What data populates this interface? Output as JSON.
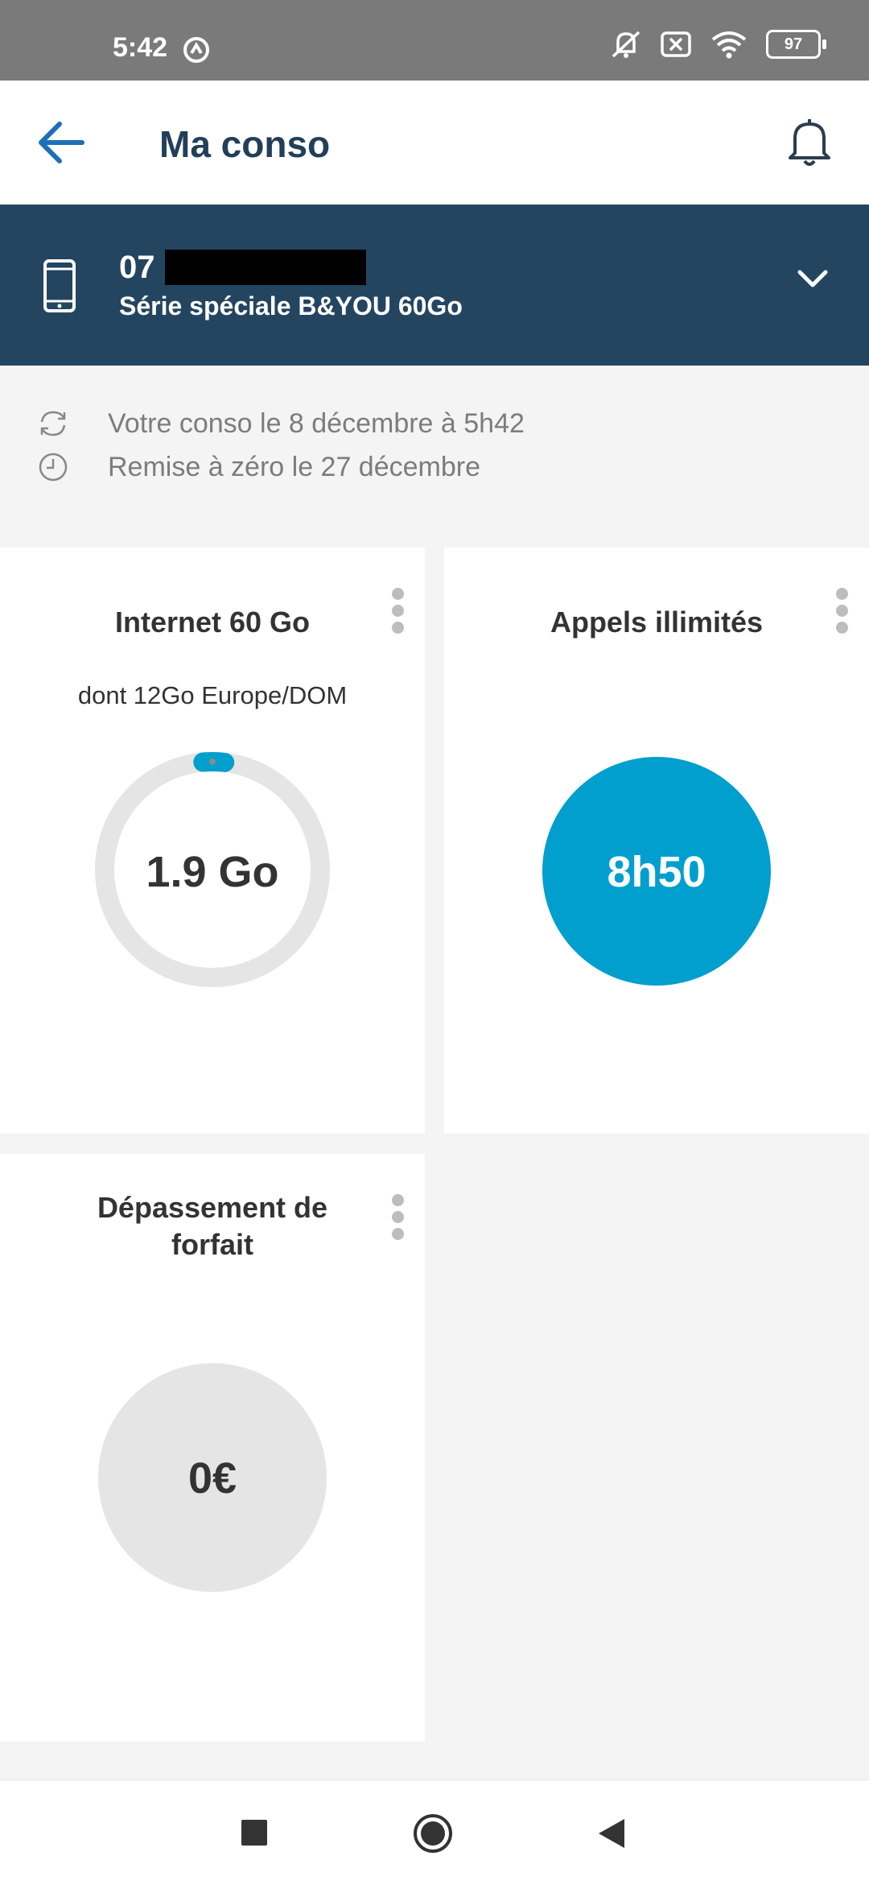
{
  "status_bar": {
    "time": "5:42",
    "battery": "97",
    "icons": [
      "vpn-icon",
      "mute-icon",
      "no-sim-icon",
      "wifi-icon",
      "battery-icon"
    ]
  },
  "app_bar": {
    "title": "Ma conso",
    "icons": [
      "back-arrow-icon",
      "bell-icon"
    ]
  },
  "line": {
    "number_prefix": "07",
    "offer": "Série spéciale B&YOU 60Go",
    "icons": [
      "smartphone-icon",
      "chevron-down-icon"
    ]
  },
  "info": {
    "updated": "Votre conso le 8 décembre à 5h42",
    "reset": "Remise à zéro le 27 décembre",
    "icons": [
      "refresh-icon",
      "clock-icon"
    ]
  },
  "cards": {
    "internet": {
      "title": "Internet 60 Go",
      "subtitle": "dont 12Go Europe/DOM",
      "value": "1.9 Go",
      "used_fraction": 0.032
    },
    "calls": {
      "title": "Appels illimités",
      "value": "8h50"
    },
    "overage": {
      "title": "Dépassement de forfait",
      "value": "0€"
    }
  },
  "colors": {
    "primary_dark": "#24455f",
    "accent_blue": "#009fcd",
    "ring_grey": "#e5e5e5",
    "back_arrow_blue": "#1d6fb8"
  },
  "nav_bar": {
    "icons": [
      "square-icon",
      "home-circle-icon",
      "back-triangle-icon"
    ]
  }
}
